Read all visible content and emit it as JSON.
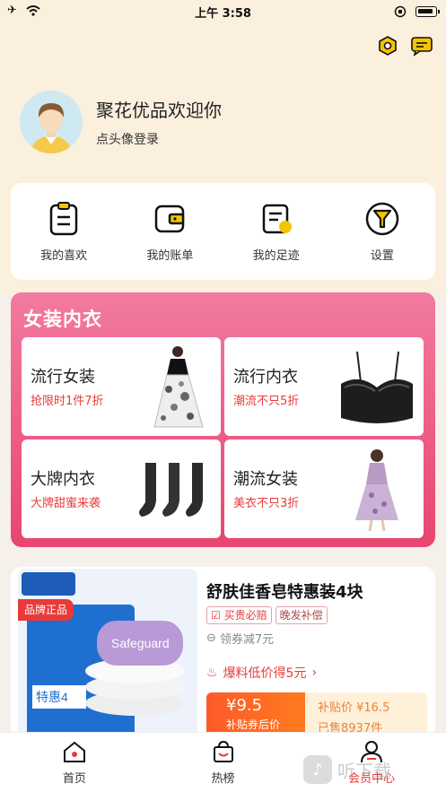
{
  "status_bar": {
    "time": "上午 3:58"
  },
  "profile": {
    "greeting": "聚花优品欢迎你",
    "login_hint": "点头像登录"
  },
  "shortcuts": [
    {
      "label": "我的喜欢",
      "icon": "clipboard-icon"
    },
    {
      "label": "我的账单",
      "icon": "wallet-icon"
    },
    {
      "label": "我的足迹",
      "icon": "footprint-icon"
    },
    {
      "label": "设置",
      "icon": "filter-icon"
    }
  ],
  "category": {
    "title": "女装内衣",
    "items": [
      {
        "name": "流行女装",
        "promo": "抢限时1件7折"
      },
      {
        "name": "流行内衣",
        "promo": "潮流不只5折"
      },
      {
        "name": "大牌内衣",
        "promo": "大牌甜蜜来袭"
      },
      {
        "name": "潮流女装",
        "promo": "美衣不只3折"
      }
    ]
  },
  "product": {
    "brand_tag": "品牌正品",
    "title": "舒肤佳香皂特惠装4块",
    "badge1": "买贵必赔",
    "badge2": "晚发补偿",
    "coupon": "领券减7元",
    "deal": "爆料低价得5元",
    "price": "¥9.5",
    "price_label": "补贴券后价",
    "subsidy_price": "补贴价 ¥16.5",
    "sold": "已售8937件",
    "image_text": "Safeguard"
  },
  "tabs": [
    {
      "label": "首页",
      "icon": "home-icon"
    },
    {
      "label": "热榜",
      "icon": "shopping-bag-icon"
    },
    {
      "label": "会员中心",
      "icon": "user-icon"
    }
  ],
  "watermark": "听下载",
  "colors": {
    "accent": "#e83a3a",
    "pink": "#e8466f",
    "cream": "#fbf0dd",
    "gold": "#f5c400"
  }
}
